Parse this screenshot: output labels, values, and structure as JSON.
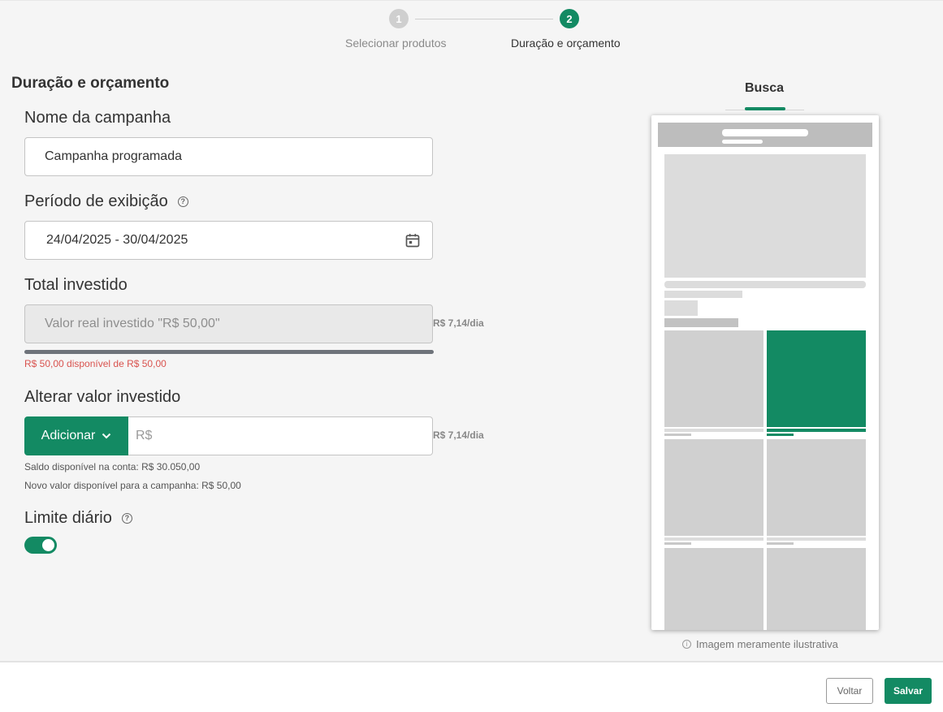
{
  "stepper": {
    "steps": [
      {
        "number": "1",
        "label": "Selecionar produtos"
      },
      {
        "number": "2",
        "label": "Duração e orçamento"
      }
    ]
  },
  "form": {
    "section_title": "Duração e orçamento",
    "campaign_name": {
      "label": "Nome da campanha",
      "value": "Campanha programada"
    },
    "period": {
      "label": "Período de exibição",
      "help_icon": "?",
      "value": "24/04/2025 - 30/04/2025"
    },
    "total": {
      "label": "Total investido",
      "placeholder": "Valor real investido \"R$ 50,00\"",
      "per_day": "R$ 7,14/dia",
      "available_text": "R$ 50,00 disponível de R$ 50,00",
      "progress_fraction": 1.0
    },
    "change": {
      "label": "Alterar valor investido",
      "add_label": "Adicionar",
      "currency_placeholder": "R$",
      "per_day": "R$ 7,14/dia",
      "account_balance": "Saldo disponível na conta: R$ 30.050,00",
      "new_value": "Novo valor disponível para a campanha: R$ 50,00"
    },
    "daily_limit": {
      "label": "Limite diário",
      "help_icon": "?",
      "enabled": true
    }
  },
  "preview": {
    "tab_label": "Busca",
    "caption": "Imagem meramente ilustrativa",
    "info_icon": "i",
    "accent_color": "#138a63"
  },
  "footer": {
    "back_label": "Voltar",
    "save_label": "Salvar"
  },
  "colors": {
    "primary": "#138a63",
    "error": "#d9534f"
  }
}
